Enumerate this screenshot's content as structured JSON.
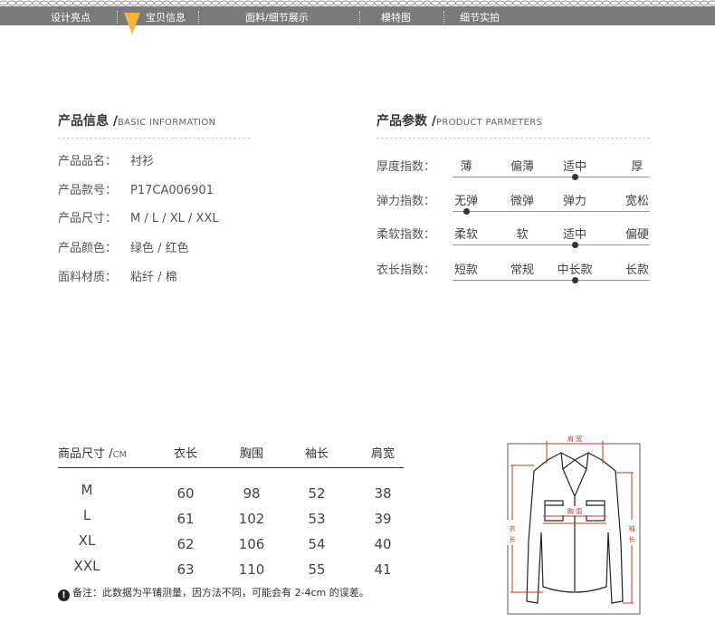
{
  "nav": {
    "items": [
      "设计亮点",
      "宝贝信息",
      "面料/细节展示",
      "模特图",
      "细节实拍"
    ],
    "active": "宝贝信息",
    "accent_color": "#f3b53c",
    "bar_color": "#7a7a7a"
  },
  "product_info": {
    "title": "产品信息 /",
    "title_en": "BASIC INFORMATION",
    "rows": [
      {
        "label": "产品品名：",
        "value": "衬衫"
      },
      {
        "label": "产品款号：",
        "value": "P17CA006901"
      },
      {
        "label": "产品尺寸：",
        "value": "M / L / XL / XXL"
      },
      {
        "label": "产品颜色：",
        "value": "绿色 / 红色"
      },
      {
        "label": "面料材质：",
        "value": "粘纤 / 棉"
      }
    ]
  },
  "product_params": {
    "title": "产品参数 /",
    "title_en": "PRODUCT PARMETERS",
    "rows": [
      {
        "label": "厚度指数：",
        "options": [
          "薄",
          "偏薄",
          "适中",
          "厚"
        ],
        "selected_index": 2
      },
      {
        "label": "弹力指数：",
        "options": [
          "无弹",
          "微弹",
          "弹力",
          "宽松"
        ],
        "selected_index": 0
      },
      {
        "label": "柔软指数：",
        "options": [
          "柔软",
          "软",
          "适中",
          "偏硬"
        ],
        "selected_index": 2
      },
      {
        "label": "衣长指数：",
        "options": [
          "短款",
          "常规",
          "中长款",
          "长款"
        ],
        "selected_index": 2
      }
    ]
  },
  "size_table": {
    "header_first": "商品尺寸 /",
    "header_first_unit": "CM",
    "columns": [
      "衣长",
      "胸围",
      "袖长",
      "肩宽"
    ],
    "rows": [
      {
        "size": "M",
        "values": [
          "60",
          "98",
          "52",
          "38"
        ]
      },
      {
        "size": "L",
        "values": [
          "61",
          "102",
          "53",
          "39"
        ]
      },
      {
        "size": "XL",
        "values": [
          "62",
          "106",
          "54",
          "40"
        ]
      },
      {
        "size": "XXL",
        "values": [
          "63",
          "110",
          "55",
          "41"
        ]
      }
    ],
    "note_icon": "!",
    "note": "备注：此数据为平铺测量，因方法不同，可能会有 2-4cm 的误差。"
  },
  "diagram": {
    "shoulder_label": "肩 宽",
    "chest_label": "胸 围",
    "length_label": [
      "衣",
      "长"
    ],
    "sleeve_label": [
      "袖",
      "长"
    ],
    "measure_color": "#c0392b"
  }
}
